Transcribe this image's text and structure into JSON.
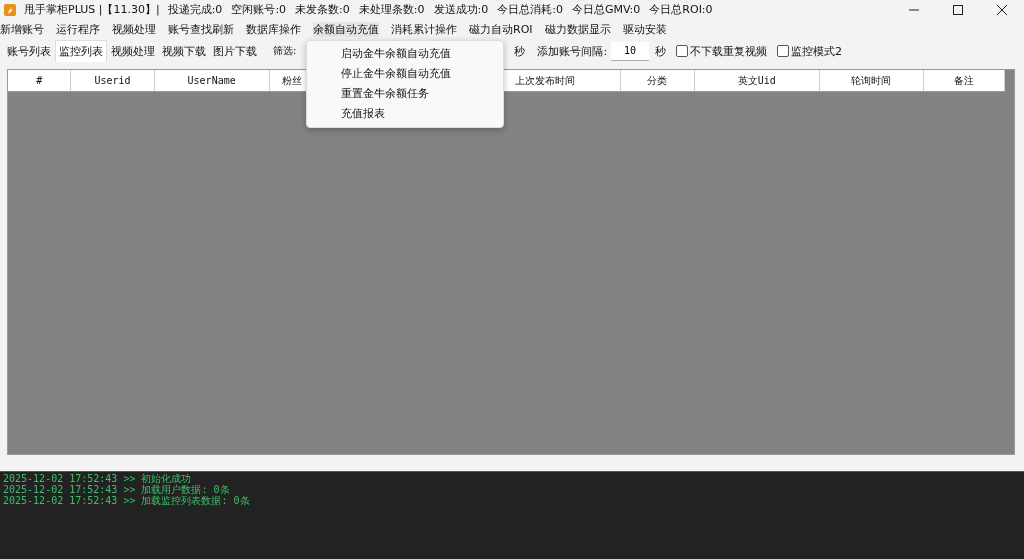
{
  "window": {
    "title": "甩手掌柜PLUS |【11.30】|",
    "stats": [
      "投递完成:0",
      "空闲账号:0",
      "未发条数:0",
      "未处理条数:0",
      "发送成功:0",
      "今日总消耗:0",
      "今日总GMV:0",
      "今日总ROI:0"
    ]
  },
  "menu_bar": [
    {
      "label": "新增账号",
      "selected": false
    },
    {
      "label": "运行程序",
      "selected": false
    },
    {
      "label": "视频处理",
      "selected": false
    },
    {
      "label": "账号查找刷新",
      "selected": false
    },
    {
      "label": "数据库操作",
      "selected": false
    },
    {
      "label": "余额自动充值",
      "selected": true
    },
    {
      "label": "消耗累计操作",
      "selected": false
    },
    {
      "label": "磁力自动ROI",
      "selected": false
    },
    {
      "label": "磁力数据显示",
      "selected": false
    },
    {
      "label": "驱动安装",
      "selected": false
    }
  ],
  "open_menu": {
    "items": [
      "启动金牛余额自动充值",
      "停止金牛余额自动充值",
      "重置金牛余额任务",
      "充值报表"
    ]
  },
  "tabs": [
    {
      "label": "账号列表",
      "selected": false
    },
    {
      "label": "监控列表",
      "selected": true
    },
    {
      "label": "视频处理",
      "selected": false
    },
    {
      "label": "视频下载",
      "selected": false
    },
    {
      "label": "图片下载",
      "selected": false
    }
  ],
  "filter_label": "筛选:",
  "filter_unit": "秒",
  "interval": {
    "label": "添加账号间隔:",
    "value": "10",
    "unit": "秒"
  },
  "checkboxes": [
    {
      "label": "不下载重复视频",
      "checked": false
    },
    {
      "label": "监控模式2",
      "checked": false
    }
  ],
  "table": {
    "columns": [
      "#",
      "Userid",
      "UserName",
      "粉丝",
      "上次发布时间",
      "分类",
      "英文Uid",
      "轮询时间",
      "备注"
    ]
  },
  "log": [
    "2025-12-02 17:52:43 >> 初始化成功",
    "2025-12-02 17:52:43 >> 加载用户数据: 0条",
    "2025-12-02 17:52:43 >> 加载监控列表数据: 0条"
  ]
}
